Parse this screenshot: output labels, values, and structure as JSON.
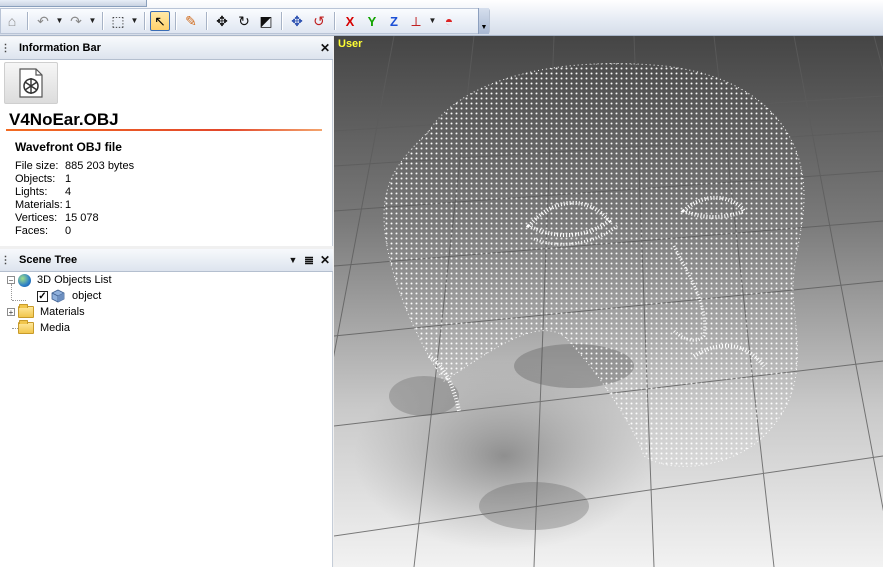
{
  "toolbar": {
    "buttons": [
      {
        "name": "home-icon",
        "glyph": "⌂"
      },
      {
        "name": "undo-icon",
        "glyph": "↶"
      },
      {
        "name": "redo-icon",
        "glyph": "↷"
      },
      {
        "name": "select-region-icon",
        "glyph": "⬚"
      },
      {
        "name": "pointer-icon",
        "glyph": "↖"
      },
      {
        "name": "render-icon",
        "glyph": "✎"
      },
      {
        "name": "move-icon",
        "glyph": "✥"
      },
      {
        "name": "rotate-icon",
        "glyph": "↻"
      },
      {
        "name": "scale-icon",
        "glyph": "◩"
      },
      {
        "name": "pan-icon",
        "glyph": "✥"
      },
      {
        "name": "orbit-icon",
        "glyph": "↺"
      }
    ],
    "axis_x": "X",
    "axis_y": "Y",
    "axis_z": "Z",
    "axis_colors": {
      "x": "#d60000",
      "y": "#12a300",
      "z": "#1b4fd6"
    }
  },
  "info_bar": {
    "title": "Information Bar",
    "file_name": "V4NoEar.OBJ",
    "file_type": "Wavefront OBJ file",
    "properties": [
      {
        "key": "File size:",
        "value": "885 203 bytes"
      },
      {
        "key": "Objects:",
        "value": "1"
      },
      {
        "key": "Lights:",
        "value": "4"
      },
      {
        "key": "Materials:",
        "value": "1"
      },
      {
        "key": "Vertices:",
        "value": "15 078"
      },
      {
        "key": "Faces:",
        "value": "0"
      }
    ]
  },
  "scene_tree": {
    "title": "Scene Tree",
    "items": [
      {
        "label": "3D Objects List",
        "expander": "−"
      },
      {
        "label": "object",
        "checked": "✓"
      },
      {
        "label": "Materials",
        "expander": "+"
      },
      {
        "label": "Media"
      }
    ]
  },
  "viewport": {
    "label": "User",
    "label_color": "#ffff33"
  }
}
